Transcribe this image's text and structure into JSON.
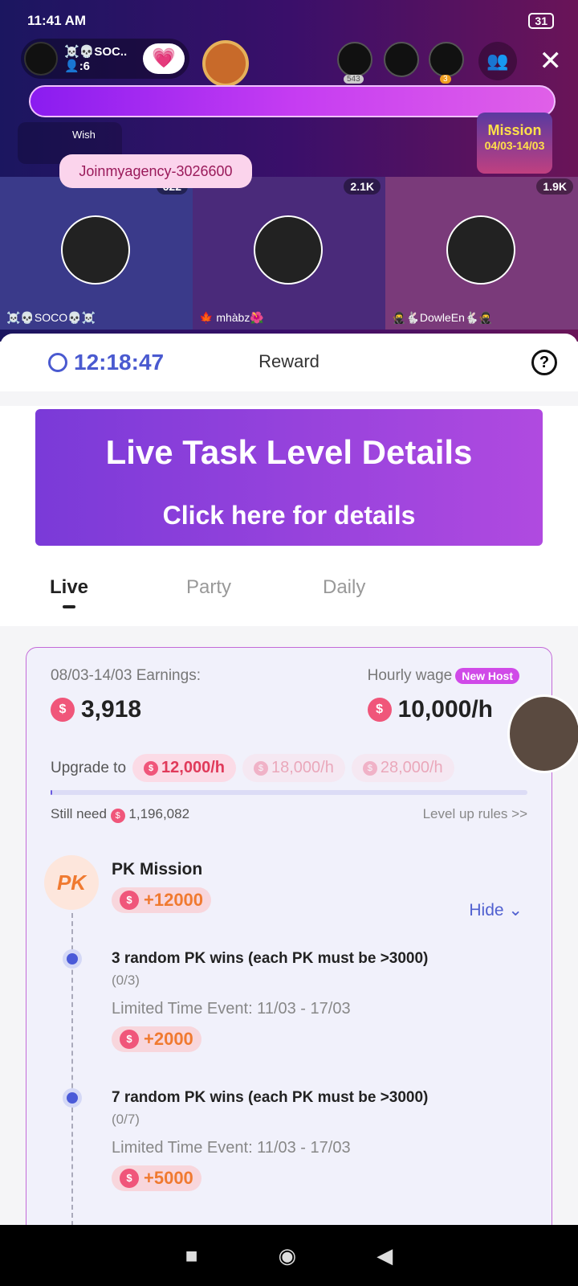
{
  "status": {
    "time": "11:41 AM",
    "battery": "31"
  },
  "live": {
    "host_name": "☠️💀SOC..",
    "viewers": ":6",
    "viewer_count_badge": "543",
    "viewer_rank_badge": "3",
    "wish_label": "Wish",
    "agency_banner": "Joinmyagency-3026600",
    "mission_badge": "Mission",
    "mission_dates": "04/03-14/03",
    "seats": [
      {
        "name": "☠️💀SOCO💀☠️",
        "count": "622"
      },
      {
        "name": "🍁 mhàbz🌺",
        "count": "2.1K"
      },
      {
        "name": "🥷🐇DowleEn🐇🥷",
        "count": "1.9K"
      }
    ]
  },
  "sheet": {
    "timer": "12:18:47",
    "title": "Reward",
    "help": "?",
    "promo": {
      "line1": "Live Task Level Details",
      "line2": "Click here for details"
    },
    "tabs": [
      {
        "label": "Live",
        "active": true
      },
      {
        "label": "Party"
      },
      {
        "label": "Daily"
      }
    ],
    "earnings": {
      "label": "08/03-14/03 Earnings:",
      "value": "3,918",
      "wage_label": "Hourly wage",
      "wage_badge": "New Host",
      "wage_value": "10,000/h"
    },
    "upgrade": {
      "label": "Upgrade to",
      "levels": [
        "12,000/h",
        "18,000/h",
        "28,000/h"
      ],
      "progress_percent": 0.3,
      "still_need_label": "Still need",
      "still_need_value": "1,196,082",
      "rules_link": "Level up rules >>"
    },
    "pk": {
      "icon": "PK",
      "title": "PK Mission",
      "reward": "+12000",
      "toggle": "Hide",
      "tasks": [
        {
          "title": "3 random PK wins (each PK must be >3000)",
          "progress": "(0/3)",
          "event": "Limited Time Event: 11/03 - 17/03",
          "reward": "+2000"
        },
        {
          "title": "7 random PK wins (each PK must be >3000)",
          "progress": "(0/7)",
          "event": "Limited Time Event: 11/03 - 17/03",
          "reward": "+5000"
        }
      ]
    }
  },
  "nav": {
    "recents": "■",
    "home": "◉",
    "back": "◀"
  }
}
